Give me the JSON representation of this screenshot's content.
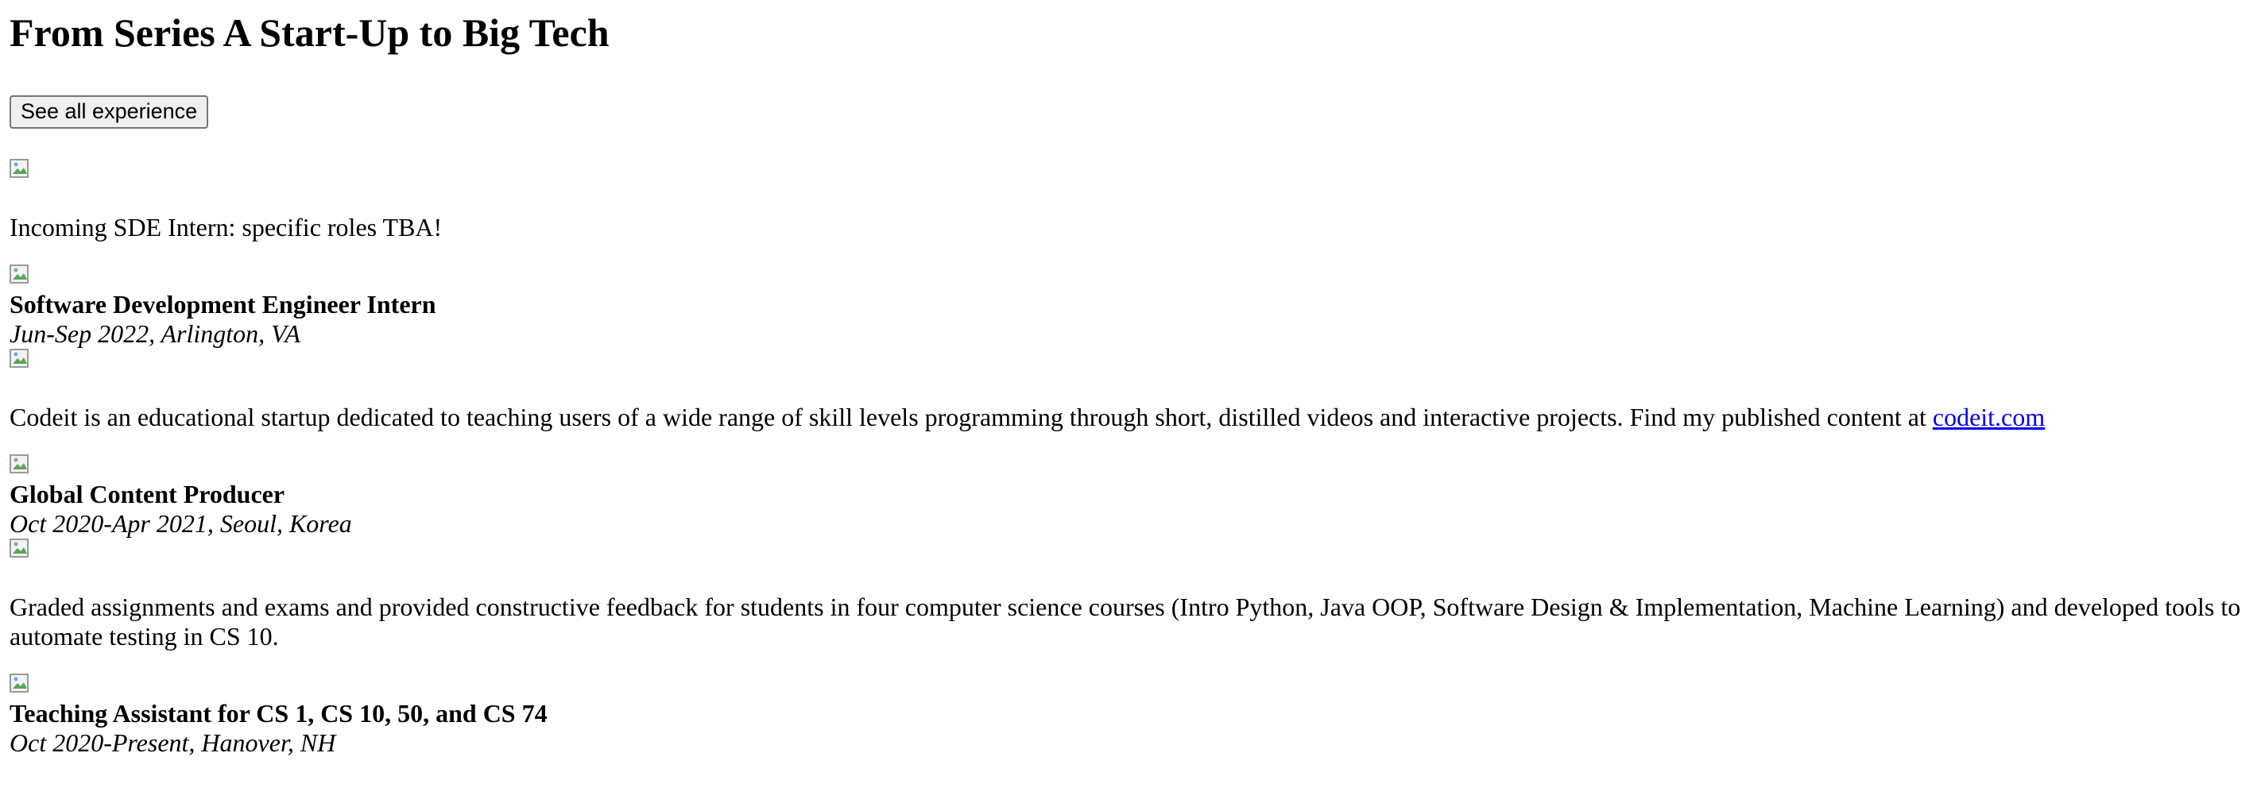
{
  "page": {
    "title": "From Series A Start-Up to Big Tech",
    "see_all_button": "See all experience"
  },
  "experience": [
    {
      "description": "Incoming SDE Intern: specific roles TBA!",
      "title": "Software Development Engineer Intern",
      "dates": "Jun-Sep 2022, Arlington, VA"
    },
    {
      "description": "Codeit is an educational startup dedicated to teaching users of a wide range of skill levels programming through short, distilled videos and interactive projects. Find my published content at ",
      "link_text": "codeit.com",
      "title": "Global Content Producer",
      "dates": "Oct 2020-Apr 2021, Seoul, Korea"
    },
    {
      "description": "Graded assignments and exams and provided constructive feedback for students in four computer science courses (Intro Python, Java OOP, Software Design & Implementation, Machine Learning) and developed tools to automate testing in CS 10.",
      "title": "Teaching Assistant for CS 1, CS 10, 50, and CS 74",
      "dates": "Oct 2020-Present, Hanover, NH"
    }
  ],
  "icons": {
    "broken_image": "broken-image-icon"
  }
}
